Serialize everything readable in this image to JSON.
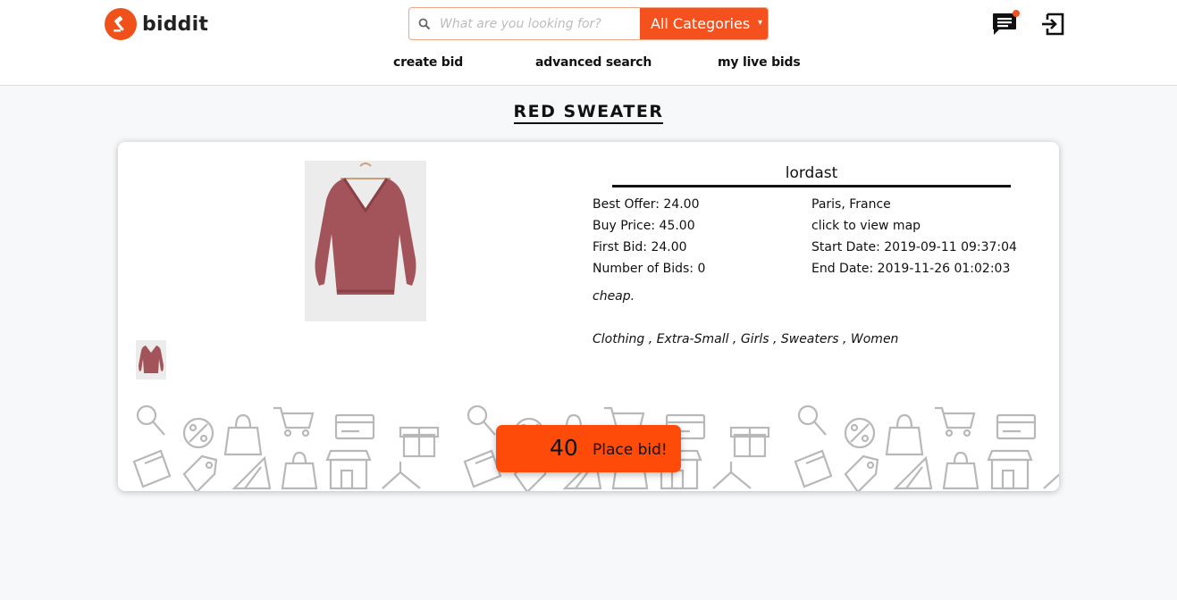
{
  "brand": {
    "name": "biddit",
    "color": "#f4511e"
  },
  "search": {
    "placeholder": "What are you looking for?",
    "value": "",
    "category": "All Categories",
    "caret": "▾"
  },
  "header_icons": {
    "messages": "chat-icon",
    "logout": "logout-icon"
  },
  "nav": [
    {
      "label": "create bid"
    },
    {
      "label": "advanced search"
    },
    {
      "label": "my live bids"
    }
  ],
  "item": {
    "title": "RED SWEATER",
    "seller": "lordast",
    "best_offer": "Best Offer: 24.00",
    "buy_price": "Buy Price: 45.00",
    "first_bid": "First Bid: 24.00",
    "num_bids": "Number of Bids: 0",
    "location": "Paris, France",
    "map_link": "click to view map",
    "start_date": "Start Date: 2019-09-11 09:37:04",
    "end_date": "End Date: 2019-11-26 01:02:03",
    "description": "cheap.",
    "categories": "Clothing , Extra-Small , Girls , Sweaters , Women"
  },
  "bid": {
    "amount": "40",
    "label": "Place bid!"
  }
}
